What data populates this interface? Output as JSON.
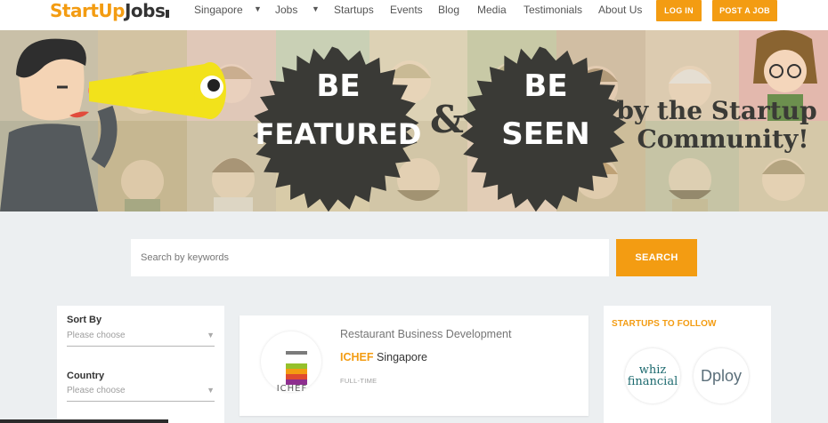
{
  "nav": {
    "logo_part1": "StartUp",
    "logo_part2": "Jobs",
    "items": [
      {
        "label": "Singapore",
        "dropdown": true
      },
      {
        "label": "Jobs",
        "dropdown": true
      },
      {
        "label": "Startups",
        "dropdown": false
      },
      {
        "label": "Events",
        "dropdown": false
      },
      {
        "label": "Blog",
        "dropdown": false
      },
      {
        "label": "Media",
        "dropdown": false
      },
      {
        "label": "Testimonials",
        "dropdown": false
      },
      {
        "label": "About Us",
        "dropdown": false
      }
    ],
    "login_label": "LOG IN",
    "post_job_label": "POST A JOB"
  },
  "banner": {
    "badge1_line1": "BE",
    "badge1_line2": "FEATURED",
    "ampersand": "&",
    "badge2_line1": "BE",
    "badge2_line2": "SEEN",
    "tagline_line1": "by the Startup",
    "tagline_line2": "Community!"
  },
  "search": {
    "placeholder": "Search by keywords",
    "button_label": "SEARCH"
  },
  "filters": [
    {
      "label": "Sort By",
      "placeholder": "Please choose"
    },
    {
      "label": "Country",
      "placeholder": "Please choose"
    }
  ],
  "job": {
    "title": "Restaurant Business Development",
    "company": "ICHEF",
    "location": "Singapore",
    "type": "FULL-TIME",
    "logo_text": "ICHEF"
  },
  "startups": {
    "title": "STARTUPS TO FOLLOW",
    "items": [
      {
        "line1": "whiz",
        "line2": "financial"
      },
      {
        "name": "Dploy"
      }
    ]
  },
  "colors": {
    "accent": "#f39c12",
    "banner_text": "#3a3a36"
  }
}
